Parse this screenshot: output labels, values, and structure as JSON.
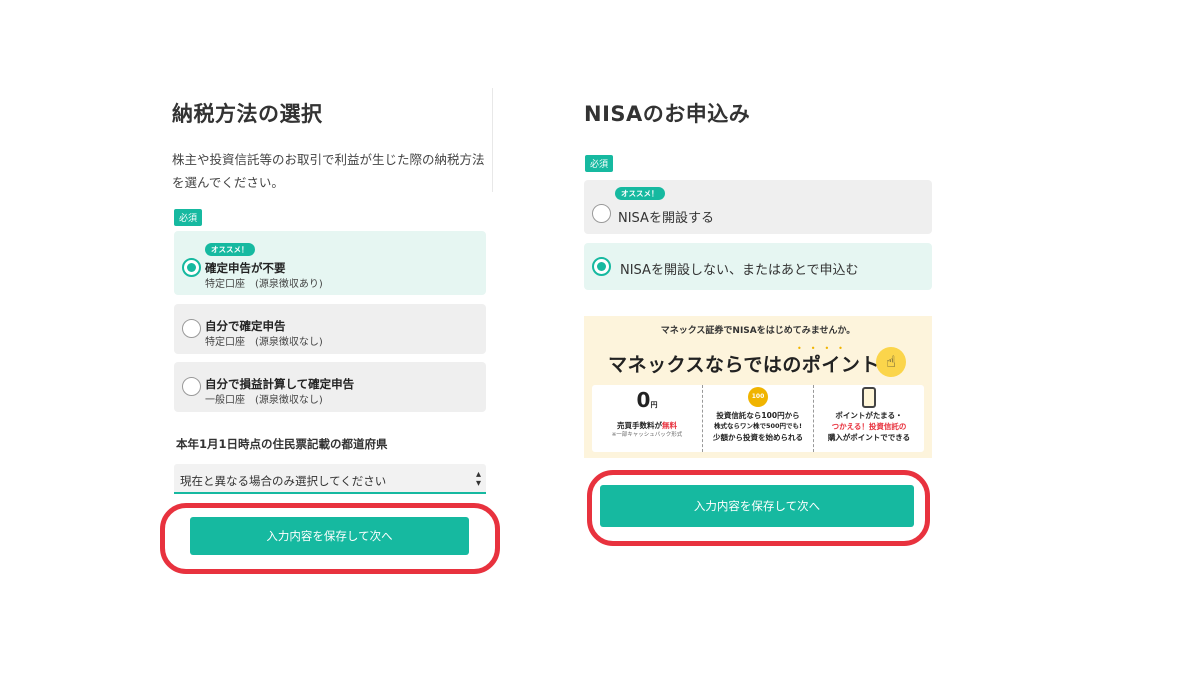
{
  "left": {
    "title": "納税方法の選択",
    "desc_line1": "株主や投資信託等のお取引で利益が生じた際の納税方法",
    "desc_line2": "を選んでください。",
    "required": "必須",
    "options": [
      {
        "recommend": "オススメ！",
        "main": "確定申告が不要",
        "sub": "特定口座　(源泉徴収あり)",
        "selected": true
      },
      {
        "main": "自分で確定申告",
        "sub": "特定口座　(源泉徴収なし)",
        "selected": false
      },
      {
        "main": "自分で損益計算して確定申告",
        "sub": "一般口座　(源泉徴収なし)",
        "selected": false
      }
    ],
    "prefecture_label": "本年1月1日時点の住民票記載の都道府県",
    "select_value": "現在と異なる場合のみ選択してください",
    "button": "入力内容を保存して次へ"
  },
  "right": {
    "title": "NISAのお申込み",
    "required": "必須",
    "options": [
      {
        "recommend": "オススメ！",
        "main": "NISAを開設する",
        "selected": false
      },
      {
        "main": "NISAを開設しない、またはあとで申込む",
        "selected": true
      }
    ],
    "banner": {
      "top": "マネックス証券でNISAをはじめてみませんか。",
      "headline": "マネックスならではのポイント",
      "card1": {
        "zero": "0",
        "yen": "円",
        "line1": "売買手数料が",
        "free": "無料",
        "note": "※一部キャッシュバック形式"
      },
      "card2": {
        "line1": "投資信託なら100円から",
        "line2": "株式ならワン株で500円でも!",
        "line3": "少額から投資を始められる"
      },
      "card3": {
        "line1": "ポイントがたまる・",
        "line2": "つかえる！投資信託の",
        "line3": "購入がポイントでできる"
      }
    },
    "button": "入力内容を保存して次へ"
  },
  "colors": {
    "accent": "#16b9a0",
    "highlight_ring": "#e8323e",
    "selected_bg": "#e6f6f2"
  }
}
